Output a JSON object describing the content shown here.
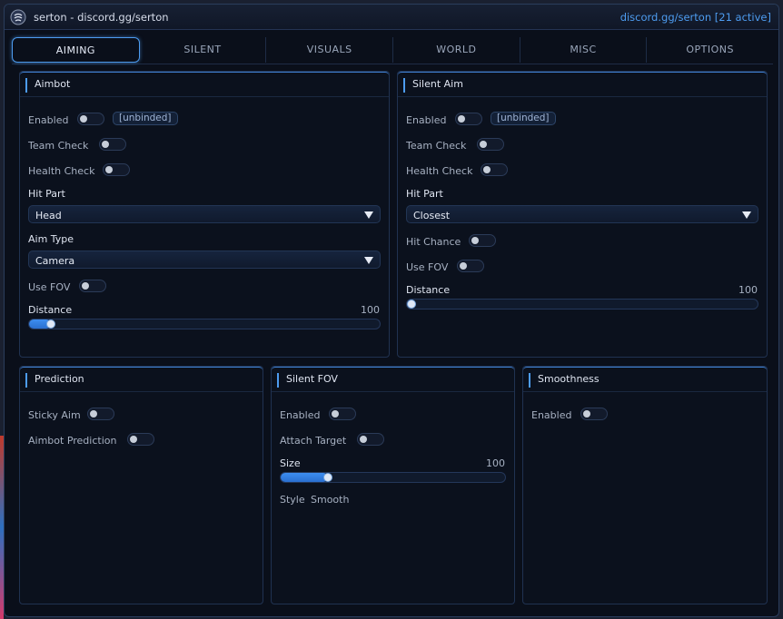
{
  "window": {
    "title": "serton - discord.gg/serton",
    "active_status": "discord.gg/serton [21 active]"
  },
  "tabs": [
    "AIMING",
    "SILENT",
    "VISUALS",
    "WORLD",
    "MISC",
    "OPTIONS"
  ],
  "aimbot": {
    "title": "Aimbot",
    "enabled_label": "Enabled",
    "keybind": "[unbinded]",
    "team_check_label": "Team Check",
    "health_check_label": "Health Check",
    "hit_part_label": "Hit Part",
    "hit_part_value": "Head",
    "aim_type_label": "Aim Type",
    "aim_type_value": "Camera",
    "use_fov_label": "Use FOV",
    "distance_label": "Distance",
    "distance_max": "100",
    "distance_fraction": 0.05
  },
  "silent_aim": {
    "title": "Silent Aim",
    "enabled_label": "Enabled",
    "keybind": "[unbinded]",
    "team_check_label": "Team Check",
    "health_check_label": "Health Check",
    "hit_part_label": "Hit Part",
    "hit_part_value": "Closest",
    "hit_chance_label": "Hit Chance",
    "use_fov_label": "Use FOV",
    "distance_label": "Distance",
    "distance_max": "100",
    "distance_fraction": 0.0
  },
  "prediction": {
    "title": "Prediction",
    "sticky_aim_label": "Sticky Aim",
    "aimbot_prediction_label": "Aimbot Prediction"
  },
  "silent_fov": {
    "title": "Silent FOV",
    "enabled_label": "Enabled",
    "attach_target_label": "Attach Target",
    "size_label": "Size",
    "size_max": "100",
    "size_fraction": 0.2,
    "style_label": "Style",
    "style_value": "Smooth"
  },
  "smoothness": {
    "title": "Smoothness",
    "enabled_label": "Enabled"
  },
  "colors": {
    "accent": "#4d9cf0",
    "background": "#0a0f1a",
    "panel_border": "#203251"
  },
  "icons": {
    "logo": "serton-logo-icon",
    "dropdown": "triangle-down-icon"
  }
}
